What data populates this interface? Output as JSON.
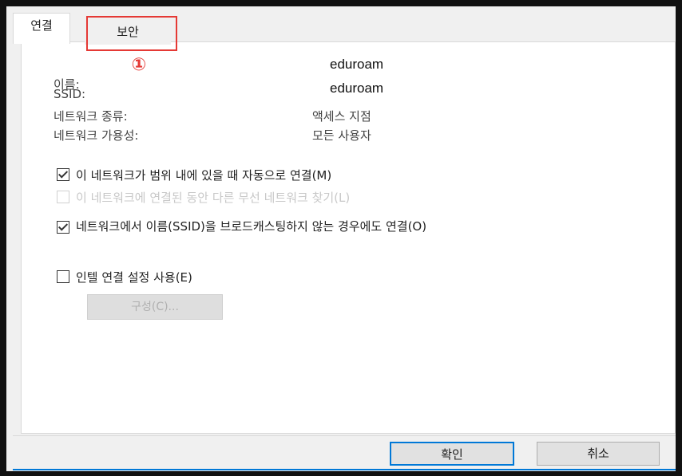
{
  "tabs": {
    "connection": "연결",
    "security": "보안"
  },
  "callout": "①",
  "details": {
    "name_label": "이름:",
    "name_value": "eduroam",
    "ssid_label": "SSID:",
    "ssid_value": "eduroam",
    "type_label": "네트워크 종류:",
    "type_value": "액세스 지점",
    "availability_label": "네트워크 가용성:",
    "availability_value": "모든 사용자"
  },
  "options": {
    "auto_connect": {
      "label": "이 네트워크가 범위 내에 있을 때 자동으로 연결(M)",
      "checked": true,
      "enabled": true
    },
    "find_other": {
      "label": "이 네트워크에 연결된 동안 다른 무선 네트워크 찾기(L)",
      "checked": false,
      "enabled": false
    },
    "hidden_ssid": {
      "label": "네트워크에서 이름(SSID)을 브로드캐스팅하지 않는 경우에도 연결(O)",
      "checked": true,
      "enabled": true
    },
    "intel_settings": {
      "label": "인텔 연결 설정 사용(E)",
      "checked": false,
      "enabled": true
    }
  },
  "config_button": "구성(C)...",
  "buttons": {
    "ok": "확인",
    "cancel": "취소"
  },
  "colors": {
    "highlight": "#e53935",
    "accent": "#0078d7"
  }
}
